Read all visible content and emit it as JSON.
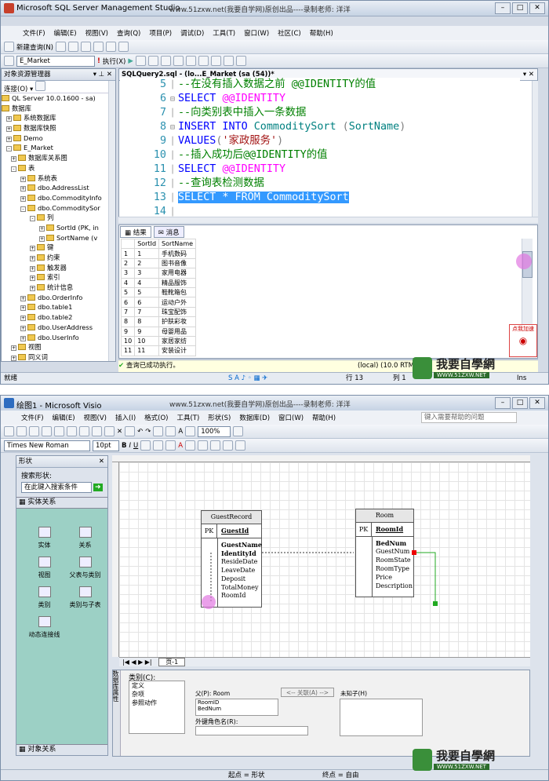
{
  "watermark": "www.51zxw.net(我要自学网)原创出品----录制老师: 洋洋",
  "ssms": {
    "title": "Microsoft SQL Server Management Studio",
    "menu": [
      "文件(F)",
      "编辑(E)",
      "视图(V)",
      "查询(Q)",
      "项目(P)",
      "调试(D)",
      "工具(T)",
      "窗口(W)",
      "社区(C)",
      "帮助(H)"
    ],
    "new_query": "新建查询(N)",
    "database": "E_Market",
    "execute": "执行(X)",
    "explorer": {
      "title": "对象资源管理器",
      "connect": "连接(O)",
      "items": [
        "QL Server 10.0.1600 - sa)",
        "数据库",
        "系统数据库",
        "数据库快照",
        "Demo",
        "E_Market",
        "数据库关系图",
        "表",
        "系统表",
        "dbo.AddressList",
        "dbo.CommodityInfo",
        "dbo.CommoditySor",
        "列",
        "SortId (PK, in",
        "SortName (v",
        "键",
        "约束",
        "触发器",
        "索引",
        "统计信息",
        "dbo.OrderInfo",
        "dbo.table1",
        "dbo.table2",
        "dbo.UserAddress",
        "dbo.UserInfo",
        "视图",
        "同义词"
      ]
    },
    "tab": "SQLQuery2.sql - (lo...E_Market (sa (54))*",
    "code_lines": [
      {
        "n": "5",
        "parts": [
          {
            "t": "--在没有插入数据之前 @@IDENTITY的值",
            "c": "cm"
          }
        ]
      },
      {
        "n": "6",
        "parts": [
          {
            "t": "SELECT ",
            "c": "kw"
          },
          {
            "t": "@@IDENTITY",
            "c": "gv"
          }
        ]
      },
      {
        "n": "7",
        "parts": [
          {
            "t": "--向类别表中插入一条数据",
            "c": "cm"
          }
        ]
      },
      {
        "n": "8",
        "parts": [
          {
            "t": "INSERT INTO ",
            "c": "kw"
          },
          {
            "t": "CommoditySort ",
            "c": "ob"
          },
          {
            "t": "(",
            "c": "gr"
          },
          {
            "t": "SortName",
            "c": "ob"
          },
          {
            "t": ")",
            "c": "gr"
          }
        ]
      },
      {
        "n": "9",
        "parts": [
          {
            "t": "VALUES",
            "c": "kw"
          },
          {
            "t": "(",
            "c": "gr"
          },
          {
            "t": "'家政服务'",
            "c": "st"
          },
          {
            "t": ")",
            "c": "gr"
          }
        ]
      },
      {
        "n": "10",
        "parts": [
          {
            "t": "--插入成功后@@IDENTITY的值",
            "c": "cm"
          }
        ]
      },
      {
        "n": "11",
        "parts": [
          {
            "t": "SELECT ",
            "c": "kw"
          },
          {
            "t": "@@IDENTITY",
            "c": "gv"
          }
        ]
      },
      {
        "n": "12",
        "parts": [
          {
            "t": "--查询表检测数据",
            "c": "cm"
          }
        ]
      },
      {
        "n": "13",
        "parts": [
          {
            "t": "SELECT * FROM CommoditySort",
            "c": "sel"
          }
        ]
      },
      {
        "n": "14",
        "parts": []
      }
    ],
    "results_tab": "结果",
    "messages_tab": "消息",
    "columns": [
      "SortId",
      "SortName"
    ],
    "rows": [
      [
        "1",
        "1",
        "手机数码"
      ],
      [
        "2",
        "2",
        "图书音像"
      ],
      [
        "3",
        "3",
        "家用电器"
      ],
      [
        "4",
        "4",
        "精品服饰"
      ],
      [
        "5",
        "5",
        "鞋靴箱包"
      ],
      [
        "6",
        "6",
        "运动户外"
      ],
      [
        "7",
        "7",
        "珠宝配饰"
      ],
      [
        "8",
        "8",
        "护肤彩妆"
      ],
      [
        "9",
        "9",
        "母婴用品"
      ],
      [
        "10",
        "10",
        "家居家纺"
      ],
      [
        "11",
        "11",
        "安装设计"
      ]
    ],
    "status_msg": "查询已成功执行。",
    "status_server": "(local) (10.0 RTM)",
    "ready": "就绪",
    "row": "行 13",
    "col": "列 1",
    "ins": "Ins",
    "badge": "点我加速"
  },
  "visio": {
    "title": "绘图1 - Microsoft Visio",
    "menu": [
      "文件(F)",
      "编辑(E)",
      "视图(V)",
      "插入(I)",
      "格式(O)",
      "工具(T)",
      "形状(S)",
      "数据库(D)",
      "窗口(W)",
      "帮助(H)"
    ],
    "help_search": "键入需要帮助的问题",
    "font": "Times New Roman",
    "size": "10pt",
    "zoom": "100%",
    "shapes_title": "形状",
    "search_label": "搜索形状:",
    "search_placeholder": "在此键入搜索条件",
    "stencil": "实体关系",
    "stencil_bottom": "对象关系",
    "shapes": [
      "实体",
      "关系",
      "视图",
      "父表与类别",
      "类别",
      "类别与子表",
      "动态连接线"
    ],
    "guest": {
      "title": "GuestRecord",
      "pk": "PK",
      "pk_field": "GuestId",
      "fields": [
        {
          "t": "GuestName",
          "b": true
        },
        {
          "t": "IdentityId",
          "b": true
        },
        {
          "t": "ResideDate",
          "b": false
        },
        {
          "t": "LeaveDate",
          "b": false
        },
        {
          "t": "Deposit",
          "b": false
        },
        {
          "t": "TotalMoney",
          "b": false
        },
        {
          "t": "RoomId",
          "b": false
        }
      ]
    },
    "room": {
      "title": "Room",
      "pk": "PK",
      "pk_field": "RoomId",
      "fields": [
        {
          "t": "BedNum",
          "b": true
        },
        {
          "t": "GuestNum",
          "b": false
        },
        {
          "t": "RoomState",
          "b": false
        },
        {
          "t": "RoomType",
          "b": false
        },
        {
          "t": "Price",
          "b": false
        },
        {
          "t": "Description",
          "b": false
        }
      ]
    },
    "page_tab": "页-1",
    "db_props": "数据库属性",
    "category": "类别(C):",
    "cat_items": [
      "定义",
      "杂项",
      "参照动作"
    ],
    "parent": "父(P): Room",
    "fk_btn": "<-- 关联(A) -->",
    "child": "未知子(H)",
    "keys": [
      "RoomID",
      "BedNum"
    ],
    "fk_role": "外键角色名(R):",
    "status_start": "起点 = 形状",
    "status_end": "终点 = 自由"
  },
  "logo": {
    "main": "我要自學網",
    "url": "WWW.51ZXW.NET"
  }
}
